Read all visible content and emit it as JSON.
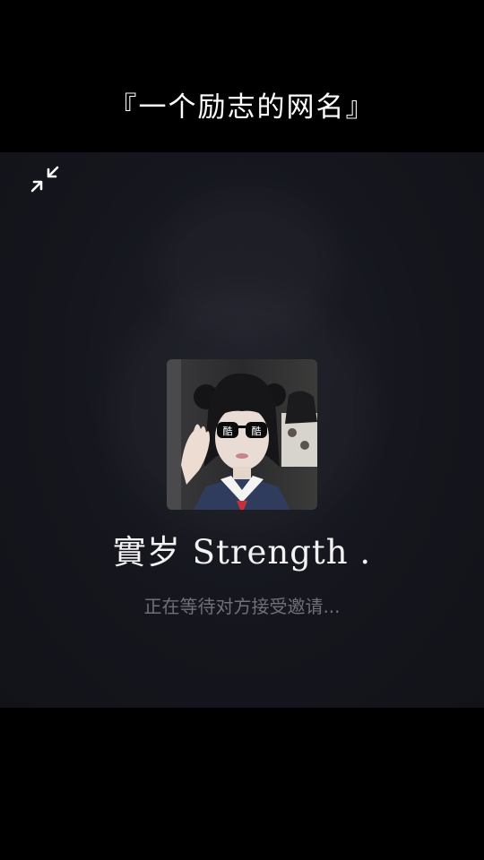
{
  "caption": {
    "text": "『一个励志的网名』"
  },
  "call": {
    "contact_name": "實岁 Strength .",
    "status": "正在等待对方接受邀请...",
    "minimize_icon": "minimize-arrows-icon",
    "avatar_sticker_left": "酷",
    "avatar_sticker_right": "酷"
  },
  "colors": {
    "page_background": "#000000",
    "call_background": "#15161d",
    "name_text": "#f2f2f2",
    "status_text": "#6f7078"
  }
}
